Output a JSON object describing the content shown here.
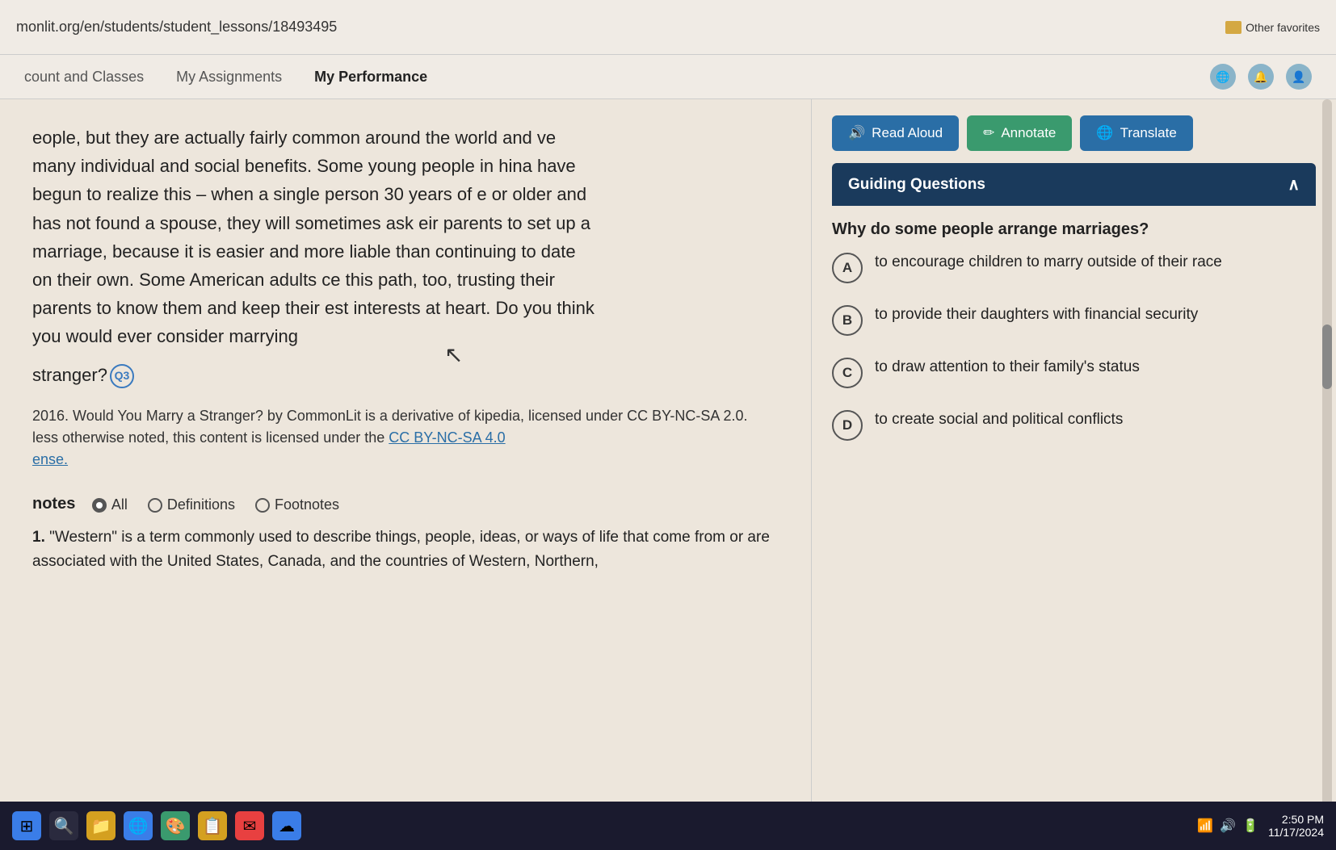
{
  "browser": {
    "url": "monlit.org/en/students/student_lessons/18493495",
    "other_favorites": "Other favorites"
  },
  "nav": {
    "items": [
      {
        "id": "count-classes",
        "label": "count and Classes",
        "active": false
      },
      {
        "id": "my-assignments",
        "label": "My Assignments",
        "active": false
      },
      {
        "id": "my-performance",
        "label": "My Performance",
        "active": false
      }
    ]
  },
  "reading": {
    "paragraph1": "eople, but they are actually fairly common around the world and ve many individual and social benefits. Some young people in hina have begun to realize this – when a single person 30 years of e or older and has not found a spouse, they will sometimes ask eir parents to set up a marriage, because it is easier and more liable than continuing to date on their own. Some American adults ce this path, too, trusting their parents to know them and keep their est interests at heart. Do you think you would ever consider marrying",
    "stranger_text": "stranger?",
    "q3_label": "Q3",
    "citation1": "2016. Would You Marry a Stranger? by CommonLit is a derivative of kipedia, licensed under CC BY-NC-SA 2.0.",
    "citation2_prefix": "less otherwise noted, this content is licensed under the ",
    "citation2_link": "CC BY-NC-SA 4.0",
    "citation2_suffix": "",
    "license_link": "ense."
  },
  "notes": {
    "label": "otes",
    "options": [
      {
        "id": "all",
        "label": "All",
        "selected": true
      },
      {
        "id": "definitions",
        "label": "Definitions",
        "selected": false
      },
      {
        "id": "footnotes",
        "label": "Footnotes",
        "selected": false
      }
    ]
  },
  "definition": {
    "number": "1.",
    "text": "\"Western\" is a term commonly used to describe things, people, ideas, or ways of life that come from or are associated with the United States, Canada, and the countries of Western, Northern,"
  },
  "right_panel": {
    "buttons": {
      "read_aloud": "Read Aloud",
      "annotate": "Annotate",
      "translate": "Translate"
    },
    "guiding_questions": {
      "header": "Guiding Questions",
      "question": "Why do some people arrange marriages?",
      "options": [
        {
          "letter": "A",
          "text": "to encourage children to marry outside of their race"
        },
        {
          "letter": "B",
          "text": "to provide their daughters with financial security"
        },
        {
          "letter": "C",
          "text": "to draw attention to their family's status"
        },
        {
          "letter": "D",
          "text": "to create social and political conflicts"
        }
      ]
    }
  },
  "taskbar": {
    "time": "2:50 PM",
    "date": "11/17/2024",
    "icons": [
      "⊞",
      "🔍",
      "📁",
      "🌐",
      "🎨",
      "⚙",
      "📧",
      "☁"
    ]
  }
}
